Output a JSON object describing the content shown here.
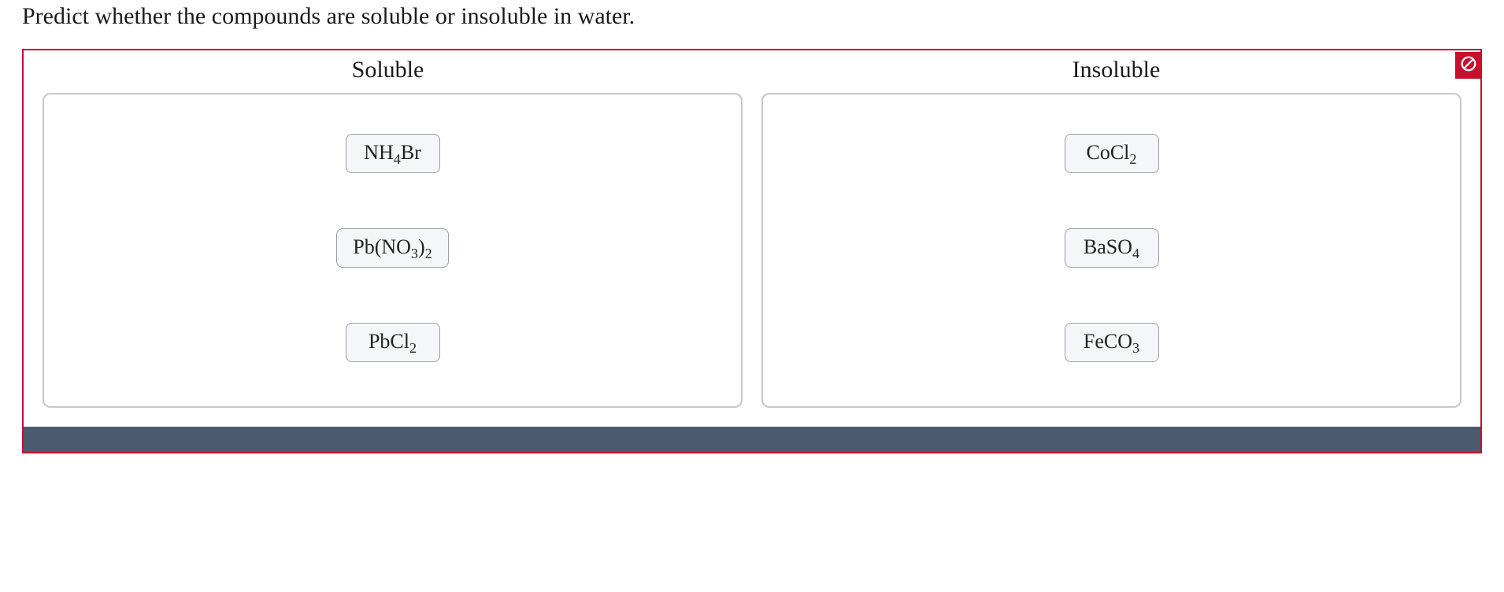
{
  "prompt": "Predict whether the compounds are soluble or insoluble in water.",
  "status": "incorrect",
  "columns": {
    "soluble": {
      "header": "Soluble",
      "items": [
        {
          "id": "nh4br",
          "formula_html": "NH<sub>4</sub>Br"
        },
        {
          "id": "pbno32",
          "formula_html": "Pb(NO<sub>3</sub>)<sub>2</sub>"
        },
        {
          "id": "pbcl2",
          "formula_html": "PbCl<sub>2</sub>"
        }
      ]
    },
    "insoluble": {
      "header": "Insoluble",
      "items": [
        {
          "id": "cocl2",
          "formula_html": "CoCl<sub>2</sub>"
        },
        {
          "id": "baso4",
          "formula_html": "BaSO<sub>4</sub>"
        },
        {
          "id": "feco3",
          "formula_html": "FeCO<sub>3</sub>"
        }
      ]
    }
  },
  "colors": {
    "error_border": "#c8102e",
    "chip_bg": "#f4f6f8",
    "chip_border": "#9aa0a6",
    "dropzone_border": "#c7c7c7",
    "bottom_bar": "#4a5a70"
  }
}
